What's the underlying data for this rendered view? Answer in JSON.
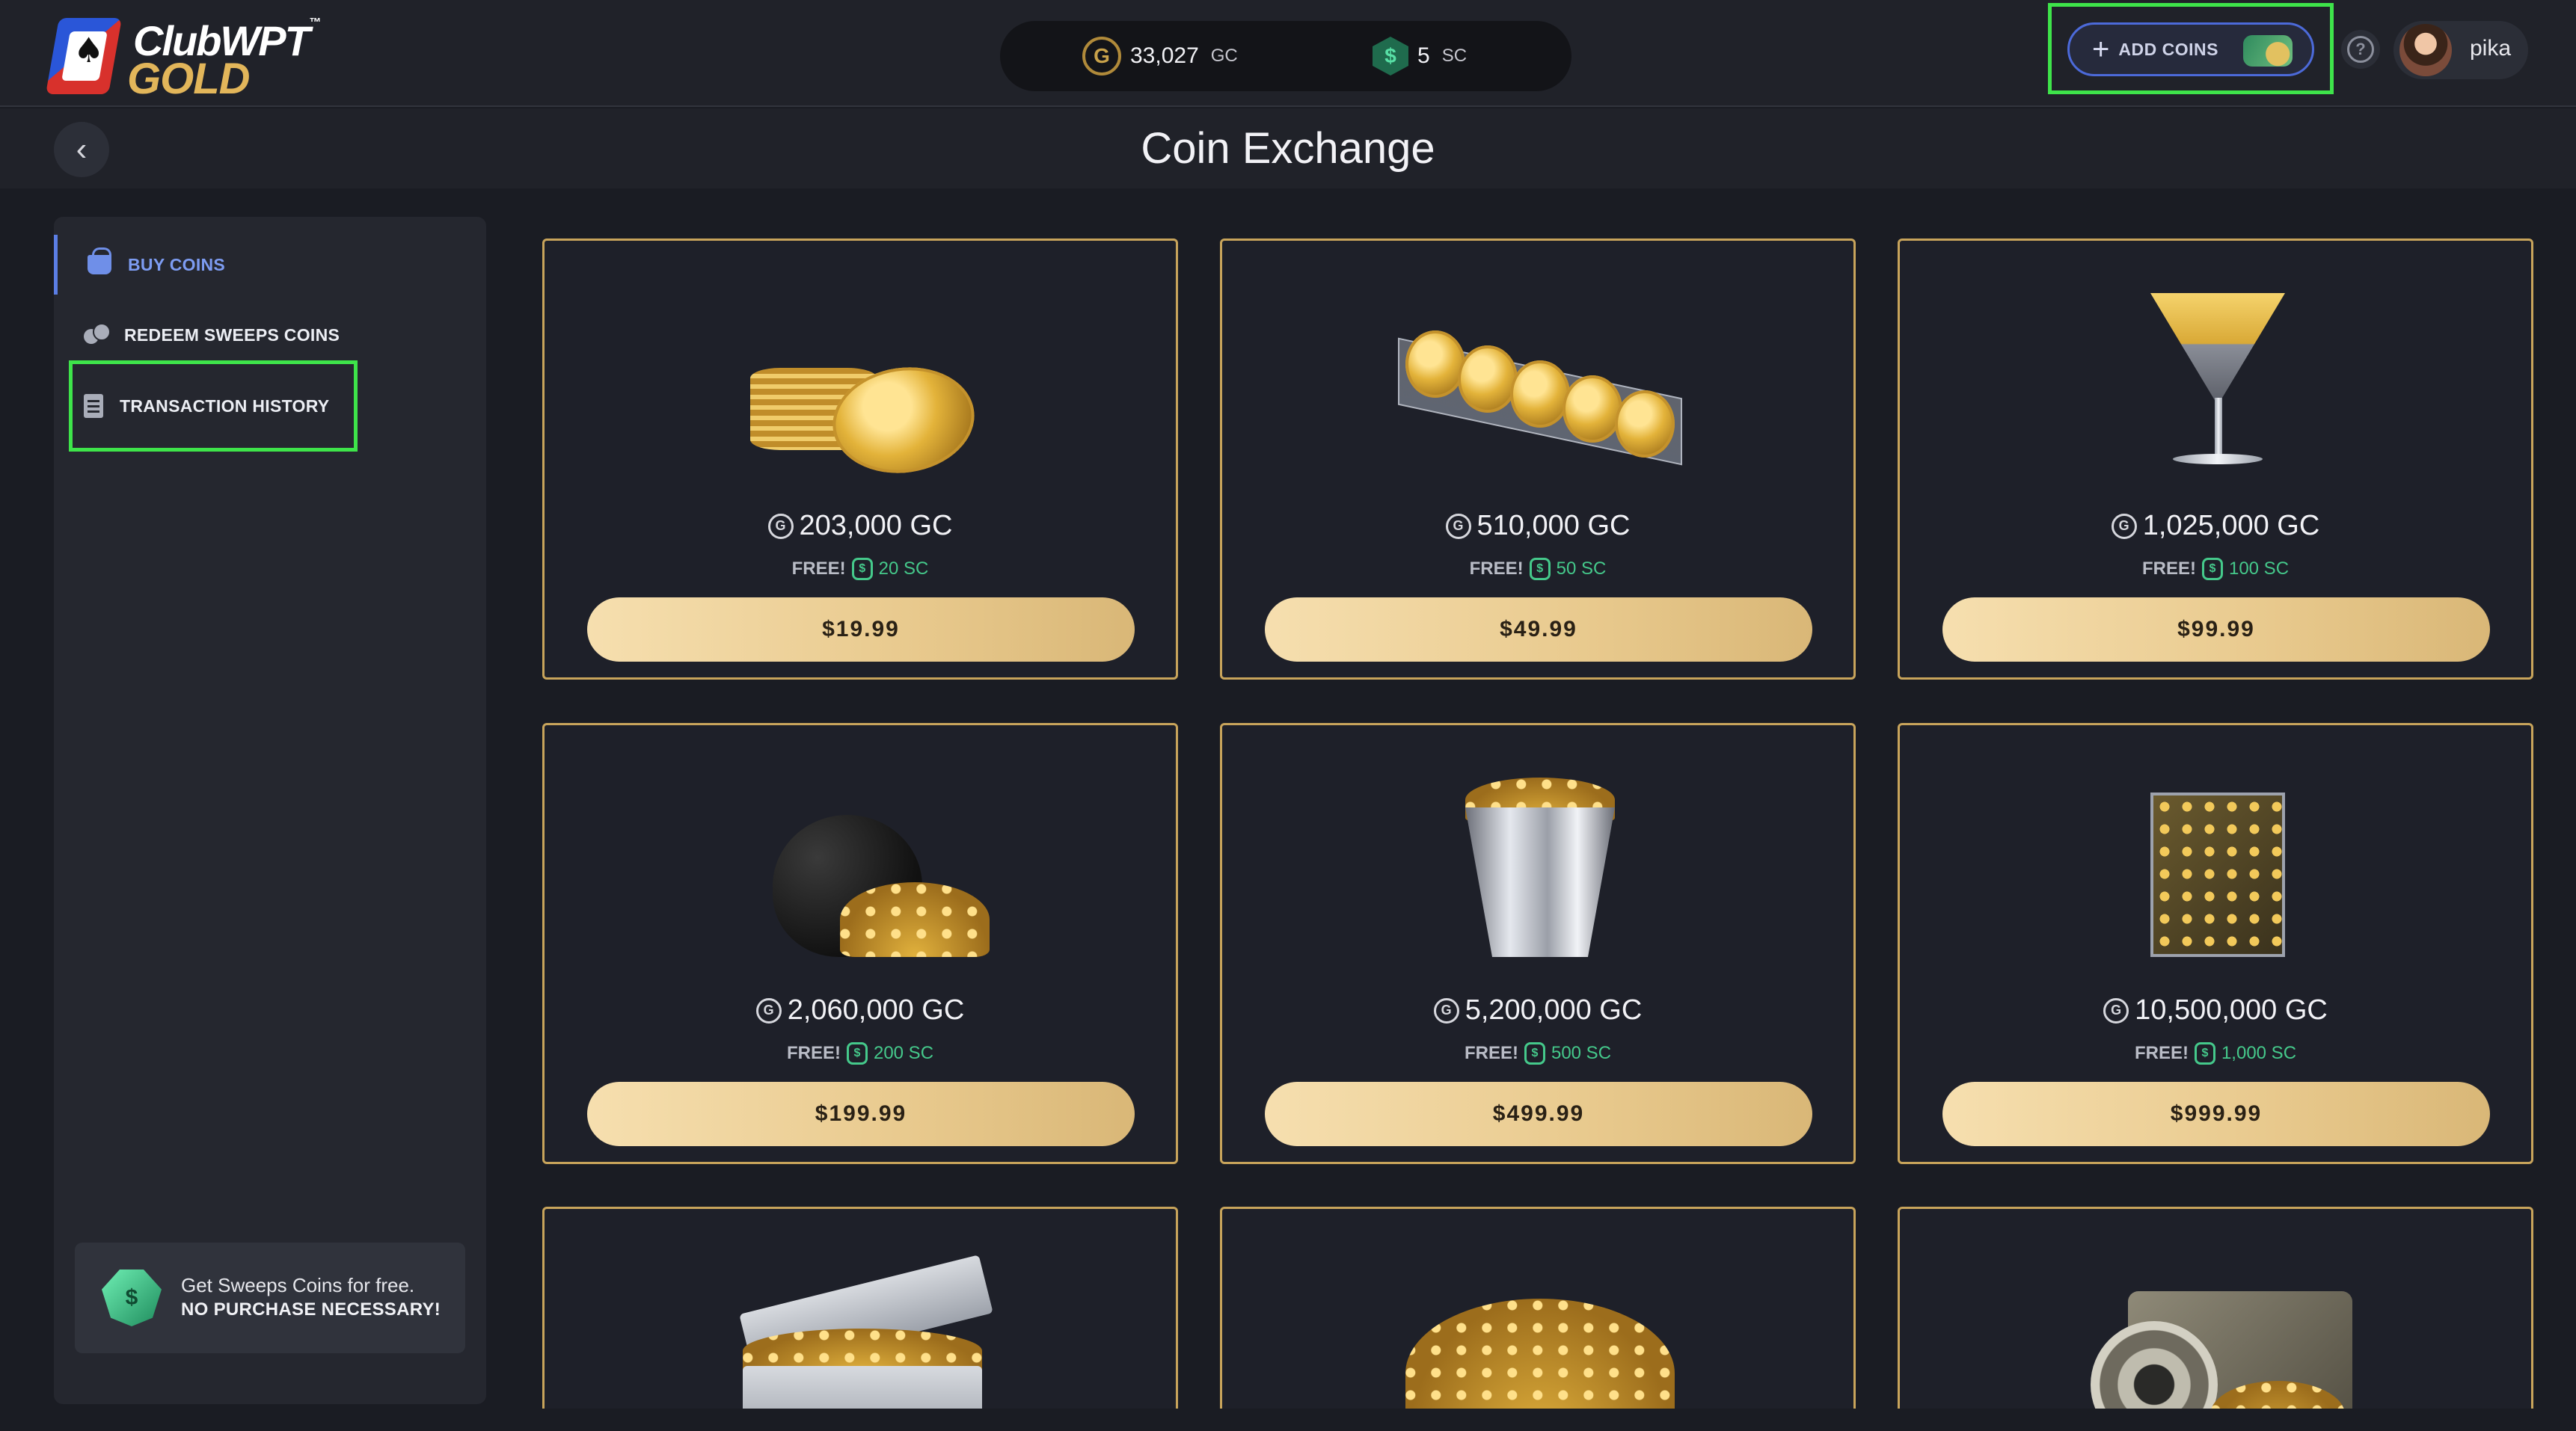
{
  "header": {
    "logo_top": "ClubWPT",
    "logo_tm": "™",
    "logo_bottom": "GOLD",
    "gc_symbol": "G",
    "sc_symbol": "$",
    "gc_balance": "33,027",
    "gc_unit": "GC",
    "sc_balance": "5",
    "sc_unit": "SC",
    "add_coins_label": "ADD COINS",
    "help_glyph": "?",
    "username": "pika"
  },
  "titlebar": {
    "back_glyph": "‹",
    "title": "Coin Exchange"
  },
  "sidebar": {
    "items": [
      {
        "label": "BUY COINS",
        "icon": "basket-icon",
        "active": true
      },
      {
        "label": "REDEEM SWEEPS COINS",
        "icon": "coins-icon",
        "active": false
      },
      {
        "label": "TRANSACTION HISTORY",
        "icon": "receipt-icon",
        "active": false
      }
    ],
    "promo": {
      "line1": "Get Sweeps Coins for free.",
      "line2": "NO PURCHASE NECESSARY!"
    }
  },
  "packages": [
    {
      "gc": "203,000 GC",
      "free": "FREE!",
      "sc": "20 SC",
      "price": "$19.99",
      "art": "coin-stack"
    },
    {
      "gc": "510,000 GC",
      "free": "FREE!",
      "sc": "50 SC",
      "price": "$49.99",
      "art": "coin-tray"
    },
    {
      "gc": "1,025,000 GC",
      "free": "FREE!",
      "sc": "100 SC",
      "price": "$99.99",
      "art": "martini-glass"
    },
    {
      "gc": "2,060,000 GC",
      "free": "FREE!",
      "sc": "200 SC",
      "price": "$199.99",
      "art": "handbag"
    },
    {
      "gc": "5,200,000 GC",
      "free": "FREE!",
      "sc": "500 SC",
      "price": "$499.99",
      "art": "bucket"
    },
    {
      "gc": "10,500,000 GC",
      "free": "FREE!",
      "sc": "1,000 SC",
      "price": "$999.99",
      "art": "coin-case"
    },
    {
      "art": "treasure-chest"
    },
    {
      "art": "coin-pile"
    },
    {
      "art": "vault"
    }
  ],
  "colors": {
    "accent_gold": "#c8a45b",
    "accent_blue": "#5b7ee5",
    "sc_green": "#45c98b",
    "highlight_green": "#3ee44a"
  }
}
